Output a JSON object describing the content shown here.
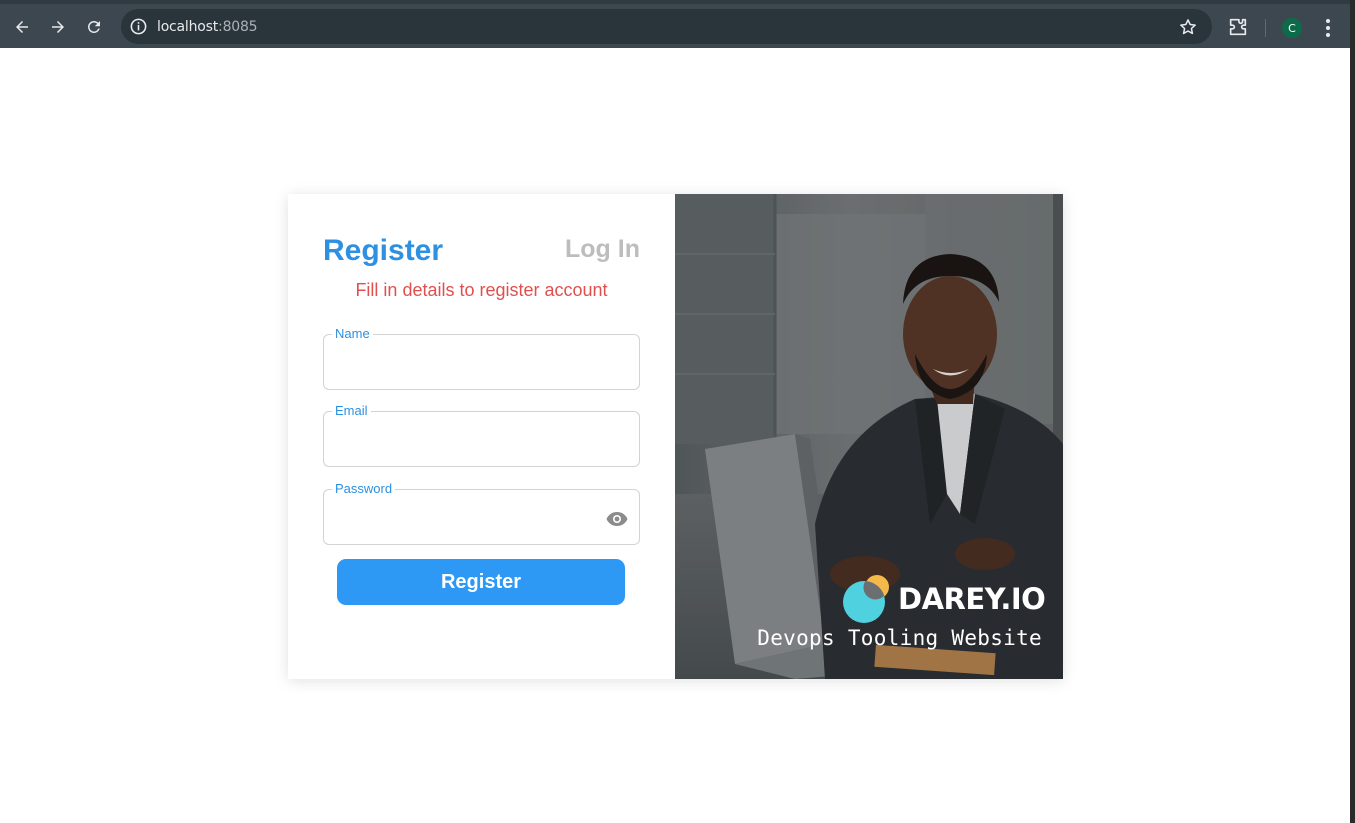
{
  "browser": {
    "url_host": "localhost",
    "url_port": ":8085",
    "avatar_letter": "C",
    "icons": [
      "back-arrow-icon",
      "forward-arrow-icon",
      "reload-icon",
      "site-info-icon",
      "bookmark-star-icon",
      "extensions-icon",
      "kebab-menu-icon"
    ]
  },
  "form": {
    "register_title": "Register",
    "login_tab": "Log In",
    "subtitle": "Fill in details to register account",
    "fields": {
      "name_label": "Name",
      "name_value": "",
      "email_label": "Email",
      "email_value": "",
      "password_label": "Password",
      "password_value": ""
    },
    "submit_label": "Register"
  },
  "branding": {
    "logo_text": "DAREY.IO",
    "tagline": "Devops Tooling Website"
  },
  "colors": {
    "accent_blue": "#2e90e0",
    "button_blue": "#2e98f5",
    "subtitle_red": "#e0504f",
    "inactive_tab": "#bdbdbd"
  }
}
